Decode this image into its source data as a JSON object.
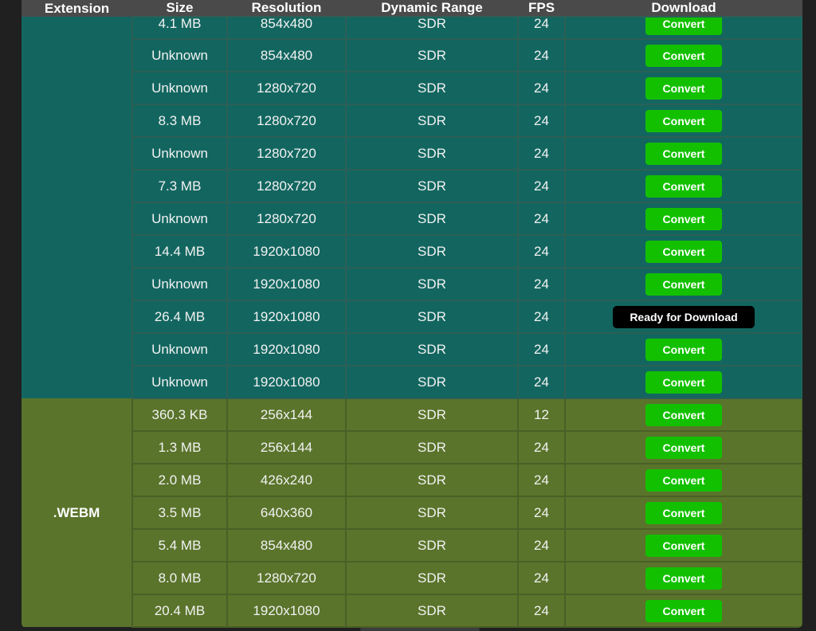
{
  "header": {
    "extension": "Extension",
    "size": "Size",
    "resolution": "Resolution",
    "dynamic_range": "Dynamic Range",
    "fps": "FPS",
    "download": "Download"
  },
  "colors": {
    "mp4_group": "#136660",
    "webm_group": "#5a742b",
    "convert_button": "#13c000",
    "ready_button": "#000000"
  },
  "mp4_group": {
    "rows": [
      {
        "size": "4.1 MB",
        "resolution": "854x480",
        "dynamic_range": "SDR",
        "fps": "24",
        "action": "Convert"
      },
      {
        "size": "Unknown",
        "resolution": "854x480",
        "dynamic_range": "SDR",
        "fps": "24",
        "action": "Convert"
      },
      {
        "size": "Unknown",
        "resolution": "1280x720",
        "dynamic_range": "SDR",
        "fps": "24",
        "action": "Convert"
      },
      {
        "size": "8.3 MB",
        "resolution": "1280x720",
        "dynamic_range": "SDR",
        "fps": "24",
        "action": "Convert"
      },
      {
        "size": "Unknown",
        "resolution": "1280x720",
        "dynamic_range": "SDR",
        "fps": "24",
        "action": "Convert"
      },
      {
        "size": "7.3 MB",
        "resolution": "1280x720",
        "dynamic_range": "SDR",
        "fps": "24",
        "action": "Convert"
      },
      {
        "size": "Unknown",
        "resolution": "1280x720",
        "dynamic_range": "SDR",
        "fps": "24",
        "action": "Convert"
      },
      {
        "size": "14.4 MB",
        "resolution": "1920x1080",
        "dynamic_range": "SDR",
        "fps": "24",
        "action": "Convert"
      },
      {
        "size": "Unknown",
        "resolution": "1920x1080",
        "dynamic_range": "SDR",
        "fps": "24",
        "action": "Convert"
      },
      {
        "size": "26.4 MB",
        "resolution": "1920x1080",
        "dynamic_range": "SDR",
        "fps": "24",
        "action": "Ready for Download"
      },
      {
        "size": "Unknown",
        "resolution": "1920x1080",
        "dynamic_range": "SDR",
        "fps": "24",
        "action": "Convert"
      },
      {
        "size": "Unknown",
        "resolution": "1920x1080",
        "dynamic_range": "SDR",
        "fps": "24",
        "action": "Convert"
      }
    ]
  },
  "webm_group": {
    "extension": ".WEBM",
    "rows": [
      {
        "size": "360.3 KB",
        "resolution": "256x144",
        "dynamic_range": "SDR",
        "fps": "12",
        "action": "Convert"
      },
      {
        "size": "1.3 MB",
        "resolution": "256x144",
        "dynamic_range": "SDR",
        "fps": "24",
        "action": "Convert"
      },
      {
        "size": "2.0 MB",
        "resolution": "426x240",
        "dynamic_range": "SDR",
        "fps": "24",
        "action": "Convert"
      },
      {
        "size": "3.5 MB",
        "resolution": "640x360",
        "dynamic_range": "SDR",
        "fps": "24",
        "action": "Convert"
      },
      {
        "size": "5.4 MB",
        "resolution": "854x480",
        "dynamic_range": "SDR",
        "fps": "24",
        "action": "Convert"
      },
      {
        "size": "8.0 MB",
        "resolution": "1280x720",
        "dynamic_range": "SDR",
        "fps": "24",
        "action": "Convert"
      },
      {
        "size": "20.4 MB",
        "resolution": "1920x1080",
        "dynamic_range": "SDR",
        "fps": "24",
        "action": "Convert"
      }
    ]
  }
}
